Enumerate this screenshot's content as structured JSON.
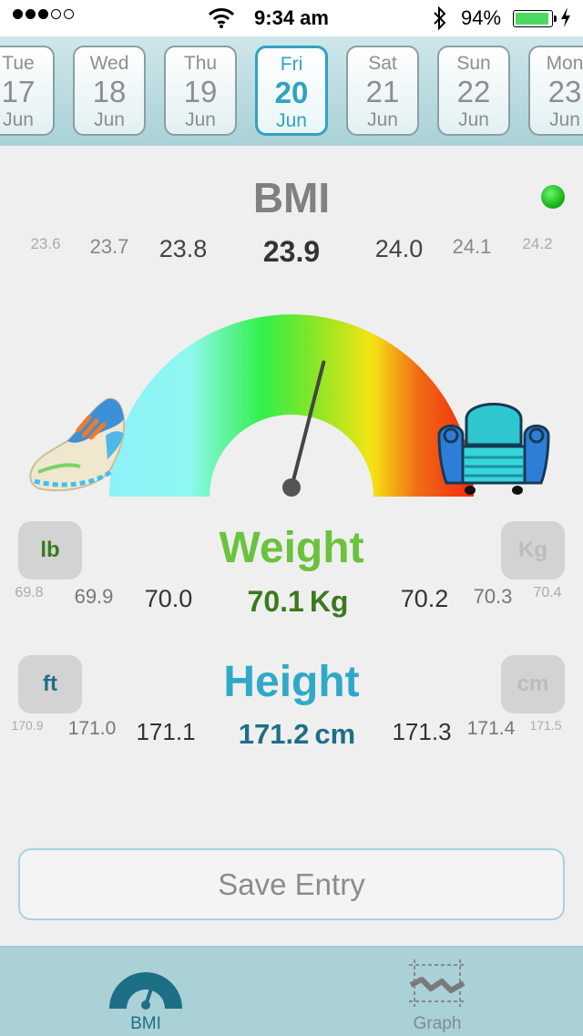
{
  "status_bar": {
    "time": "9:34 am",
    "battery_percent": "94%",
    "battery_level": 0.94,
    "signal_bars_filled": 3,
    "signal_bars_total": 5
  },
  "dates": [
    {
      "dow": "Tue",
      "day": "17",
      "month": "Jun",
      "selected": false
    },
    {
      "dow": "Wed",
      "day": "18",
      "month": "Jun",
      "selected": false
    },
    {
      "dow": "Thu",
      "day": "19",
      "month": "Jun",
      "selected": false
    },
    {
      "dow": "Fri",
      "day": "20",
      "month": "Jun",
      "selected": true
    },
    {
      "dow": "Sat",
      "day": "21",
      "month": "Jun",
      "selected": false
    },
    {
      "dow": "Sun",
      "day": "22",
      "month": "Jun",
      "selected": false
    },
    {
      "dow": "Mon",
      "day": "23",
      "month": "Jun",
      "selected": false
    }
  ],
  "bmi": {
    "title": "BMI",
    "status_color": "#1fbf1f",
    "scale": [
      "23.6",
      "23.7",
      "23.8",
      "23.9",
      "24.0",
      "24.1",
      "24.2"
    ],
    "current_index": 3
  },
  "gauge": {
    "icon_left": "running-shoe-icon",
    "icon_right": "armchair-icon",
    "needle_fraction": 0.58
  },
  "weight": {
    "title": "Weight",
    "title_color": "#6ac23d",
    "value_color": "#3a7a1d",
    "unit_left": "lb",
    "unit_right": "Kg",
    "current_unit": "Kg",
    "scale": [
      "69.8",
      "69.9",
      "70.0",
      "70.1",
      "70.2",
      "70.3",
      "70.4"
    ],
    "current_index": 3
  },
  "height": {
    "title": "Height",
    "title_color": "#2fa9c6",
    "value_color": "#1d6f86",
    "unit_left": "ft",
    "unit_right": "cm",
    "current_unit": "cm",
    "scale": [
      "170.9",
      "171.0",
      "171.1",
      "171.2",
      "171.3",
      "171.4",
      "171.5"
    ],
    "current_index": 3
  },
  "save_label": "Save Entry",
  "tabs": [
    {
      "label": "BMI",
      "icon": "gauge-icon",
      "active": true
    },
    {
      "label": "Graph",
      "icon": "graph-icon",
      "active": false
    }
  ]
}
